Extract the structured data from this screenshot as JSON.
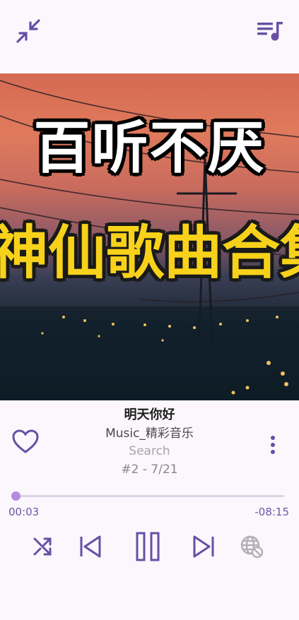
{
  "player": {
    "artwork": {
      "line1": "百听不厌",
      "line2": "神仙歌曲合集"
    },
    "song_title": "明天你好",
    "artist": "Music_精彩音乐",
    "album": "Search",
    "track_position": "#2 - 7/21",
    "progress_fraction": 0.006,
    "time_elapsed": "00:03",
    "time_remaining": "-08:15"
  },
  "icons": {
    "collapse": "collapse-arrows-icon",
    "queue": "playlist-music-icon",
    "favorite": "heart-outline-icon",
    "more": "more-vert-icon",
    "shuffle": "shuffle-icon",
    "previous": "skip-previous-icon",
    "play_pause": "pause-icon",
    "next": "skip-next-icon",
    "cast": "globe-blocked-icon"
  },
  "colors": {
    "accent": "#6750a4",
    "background": "#fbf7fc",
    "artwork_yellow": "#f8d21a"
  }
}
